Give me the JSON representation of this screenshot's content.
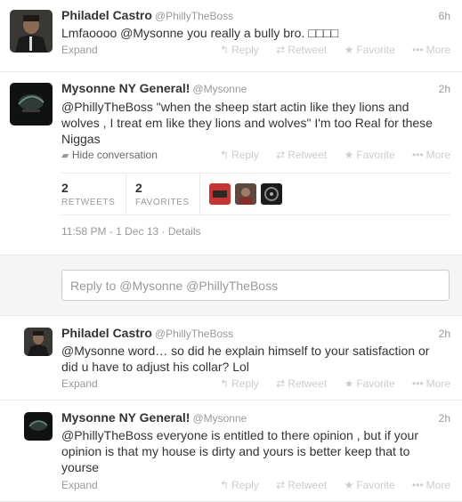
{
  "tweets": [
    {
      "fullname": "Philadel Castro",
      "username": "@PhillyTheBoss",
      "time": "6h",
      "text": "Lmfaoooo @Mysonne you really a bully bro. □□□□",
      "expand": "Expand"
    },
    {
      "fullname": "Mysonne NY General!",
      "username": "@Mysonne",
      "time": "2h",
      "text": "@PhillyTheBoss \"when the sheep start actin like they lions and wolves , I treat em like they lions and wolves\" I'm too Real for these Niggas",
      "hide": "Hide conversation",
      "retweets_count": "2",
      "retweets_label": "RETWEETS",
      "favorites_count": "2",
      "favorites_label": "FAVORITES",
      "timestamp": "11:58 PM - 1 Dec 13 · Details"
    },
    {
      "fullname": "Philadel Castro",
      "username": "@PhillyTheBoss",
      "time": "2h",
      "text": "@Mysonne word… so did he explain himself to your satisfaction or did u have to adjust his collar? Lol",
      "expand": "Expand"
    },
    {
      "fullname": "Mysonne NY General!",
      "username": "@Mysonne",
      "time": "2h",
      "text": "@PhillyTheBoss everyone is entitled to there opinion , but if your opinion is that my house is dirty and yours is better keep that to yourse",
      "expand": "Expand"
    }
  ],
  "actions": {
    "reply": "Reply",
    "retweet": "Retweet",
    "favorite": "Favorite",
    "more": "More"
  },
  "icons": {
    "reply": "reply-arrow-icon",
    "retweet": "retweet-icon",
    "favorite": "star-icon",
    "more": "more-dots-icon",
    "hide": "speech-bubble-icon"
  },
  "reply_box": {
    "placeholder": "Reply to @Mysonne @PhillyTheBoss"
  },
  "colors": {
    "text": "#333333",
    "muted": "#999999",
    "border": "#e8e8e8",
    "reply_bg": "#f5f5f5"
  }
}
